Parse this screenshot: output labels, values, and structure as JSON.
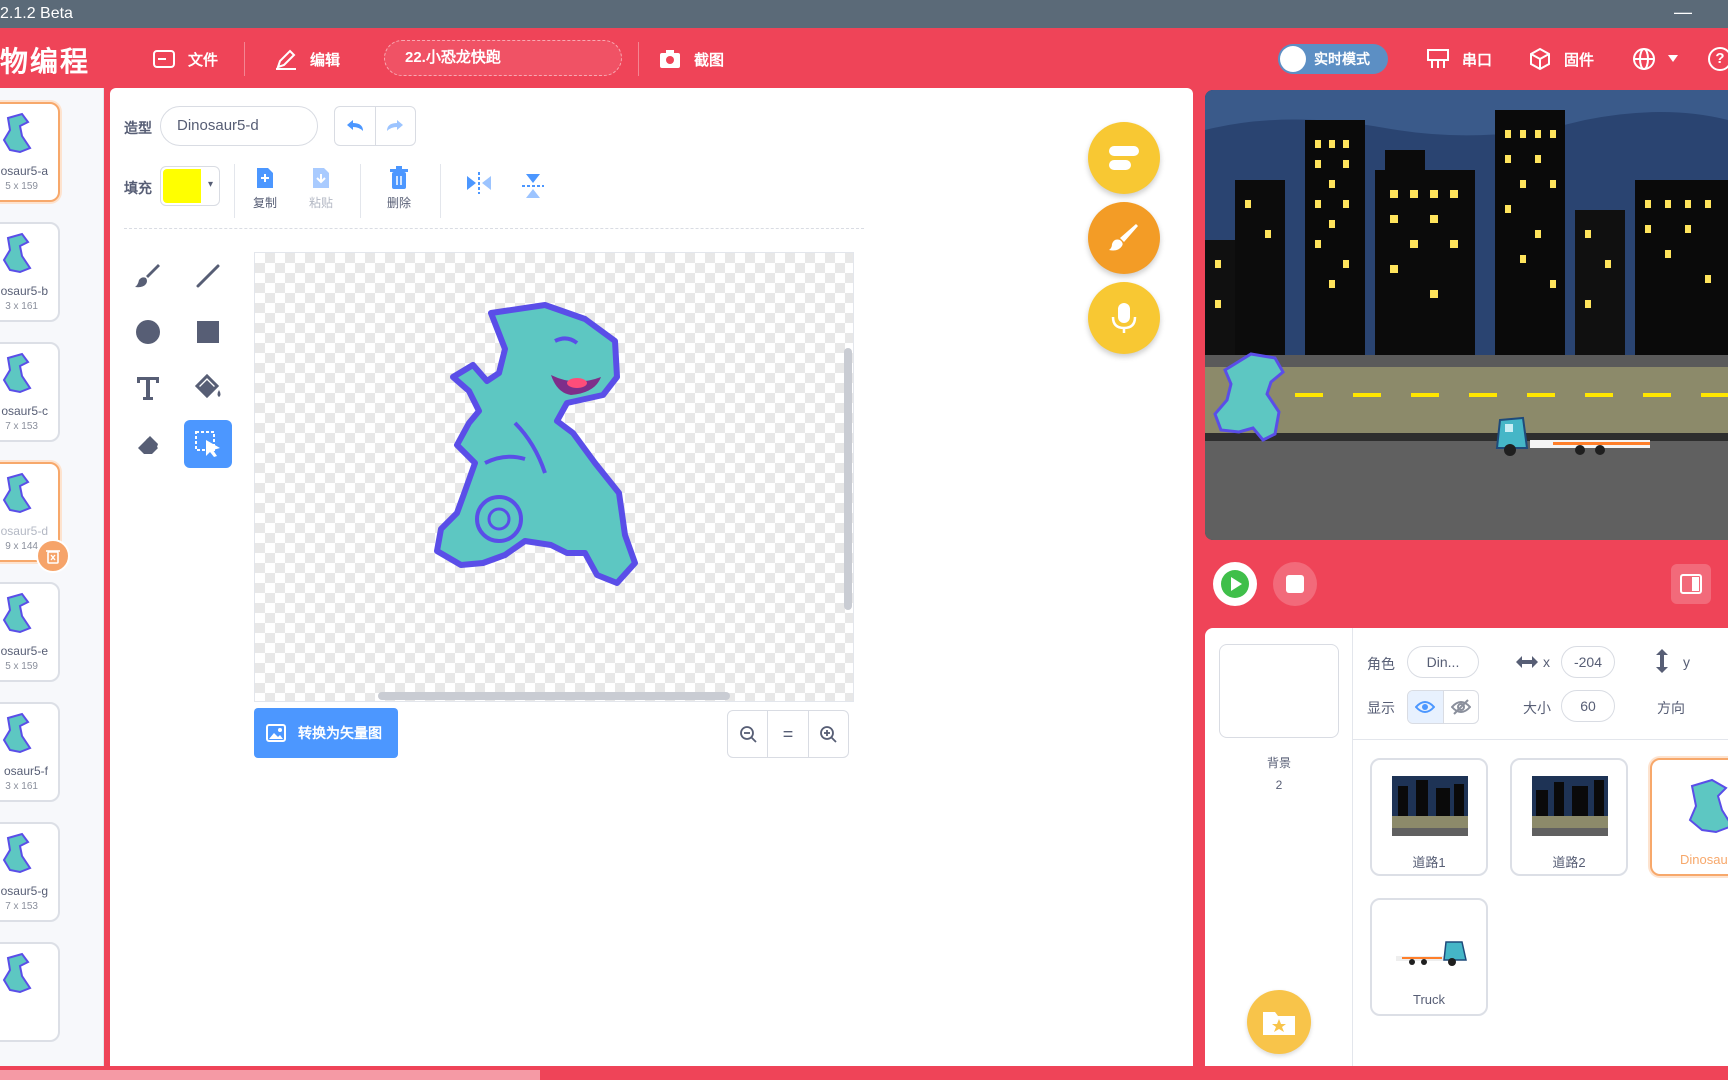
{
  "titlebar": {
    "title": "2.1.2 Beta",
    "minimize": "—"
  },
  "menubar": {
    "brand": "物编程",
    "file": "文件",
    "edit": "编辑",
    "project_name": "22.小恐龙快跑",
    "screenshot": "截图",
    "realtime_mode": "实时模式",
    "serial": "串口",
    "firmware": "固件",
    "help": "?"
  },
  "costume_list": [
    {
      "name": "osaur5-a",
      "size": "5 x 159"
    },
    {
      "name": "osaur5-b",
      "size": "3 x 161"
    },
    {
      "name": "osaur5-c",
      "size": "7 x 153"
    },
    {
      "name": "osaur5-d",
      "size": "9 x 144"
    },
    {
      "name": "osaur5-e",
      "size": "5 x 159"
    },
    {
      "name": "osaur5-f",
      "size": "3 x 161"
    },
    {
      "name": "osaur5-g",
      "size": "7 x 153"
    }
  ],
  "editor": {
    "costume_label": "造型",
    "costume_name": "Dinosaur5-d",
    "fill_label": "填充",
    "fill_color": "#ffff00",
    "copy": "复制",
    "paste": "粘贴",
    "delete": "删除",
    "convert_vector": "转换为矢量图",
    "zoom_reset": "="
  },
  "stage_info": {
    "sprite_label": "角色",
    "sprite_name": "Din...",
    "x_label": "x",
    "x_value": "-204",
    "y_label": "y",
    "show_label": "显示",
    "size_label": "大小",
    "size_value": "60",
    "direction_label": "方向",
    "backdrop_label": "背景",
    "backdrop_count": "2"
  },
  "sprites": [
    {
      "name": "道路1"
    },
    {
      "name": "道路2"
    },
    {
      "name": "Dinosaur"
    },
    {
      "name": "Truck"
    }
  ],
  "colors": {
    "brand_red": "#ef4458",
    "accent_blue": "#4c97ff",
    "orange": "#f7a86b",
    "yellow": "#f8c44a"
  }
}
